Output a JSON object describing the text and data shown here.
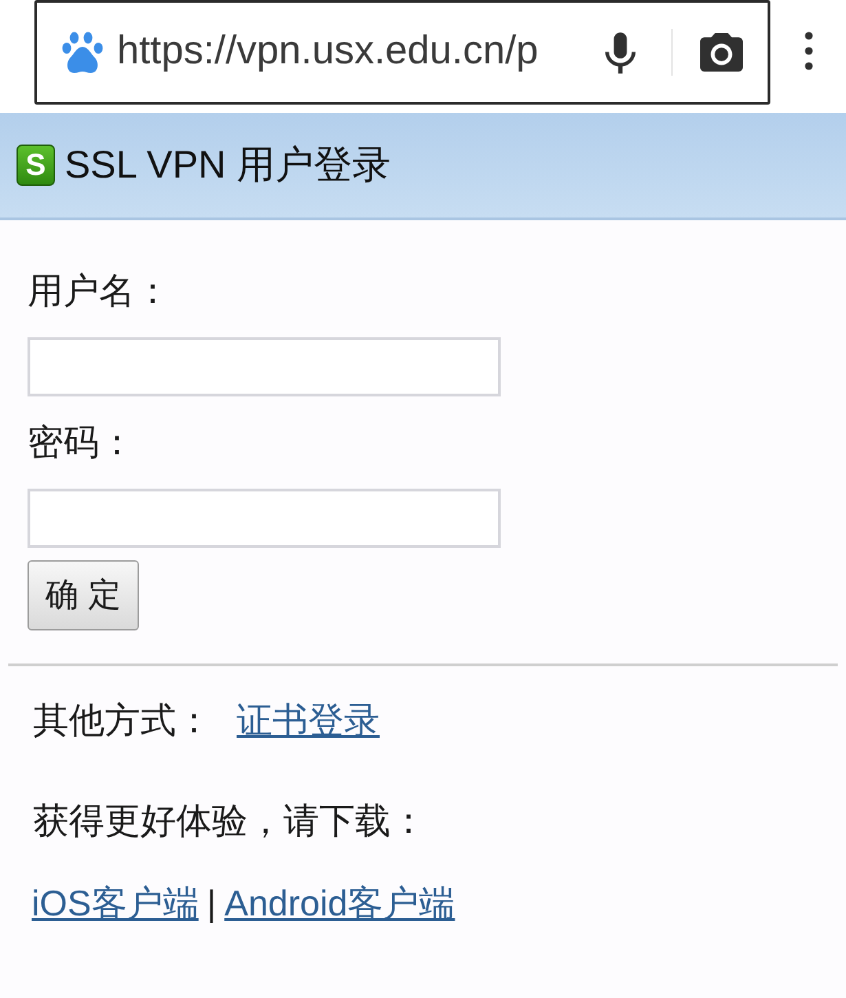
{
  "browser": {
    "url": "https://vpn.usx.edu.cn/p"
  },
  "header": {
    "logo_letter": "S",
    "title": "SSL VPN 用户登录"
  },
  "form": {
    "fields": [
      {
        "label": "用户名："
      },
      {
        "label": "密码："
      }
    ],
    "submit": "确 定"
  },
  "other_methods": {
    "label": "其他方式：",
    "link": "证书登录"
  },
  "download": {
    "text": "获得更好体验，请下载：",
    "links": [
      "iOS客户端",
      "Android客户端"
    ],
    "separator": "|"
  }
}
